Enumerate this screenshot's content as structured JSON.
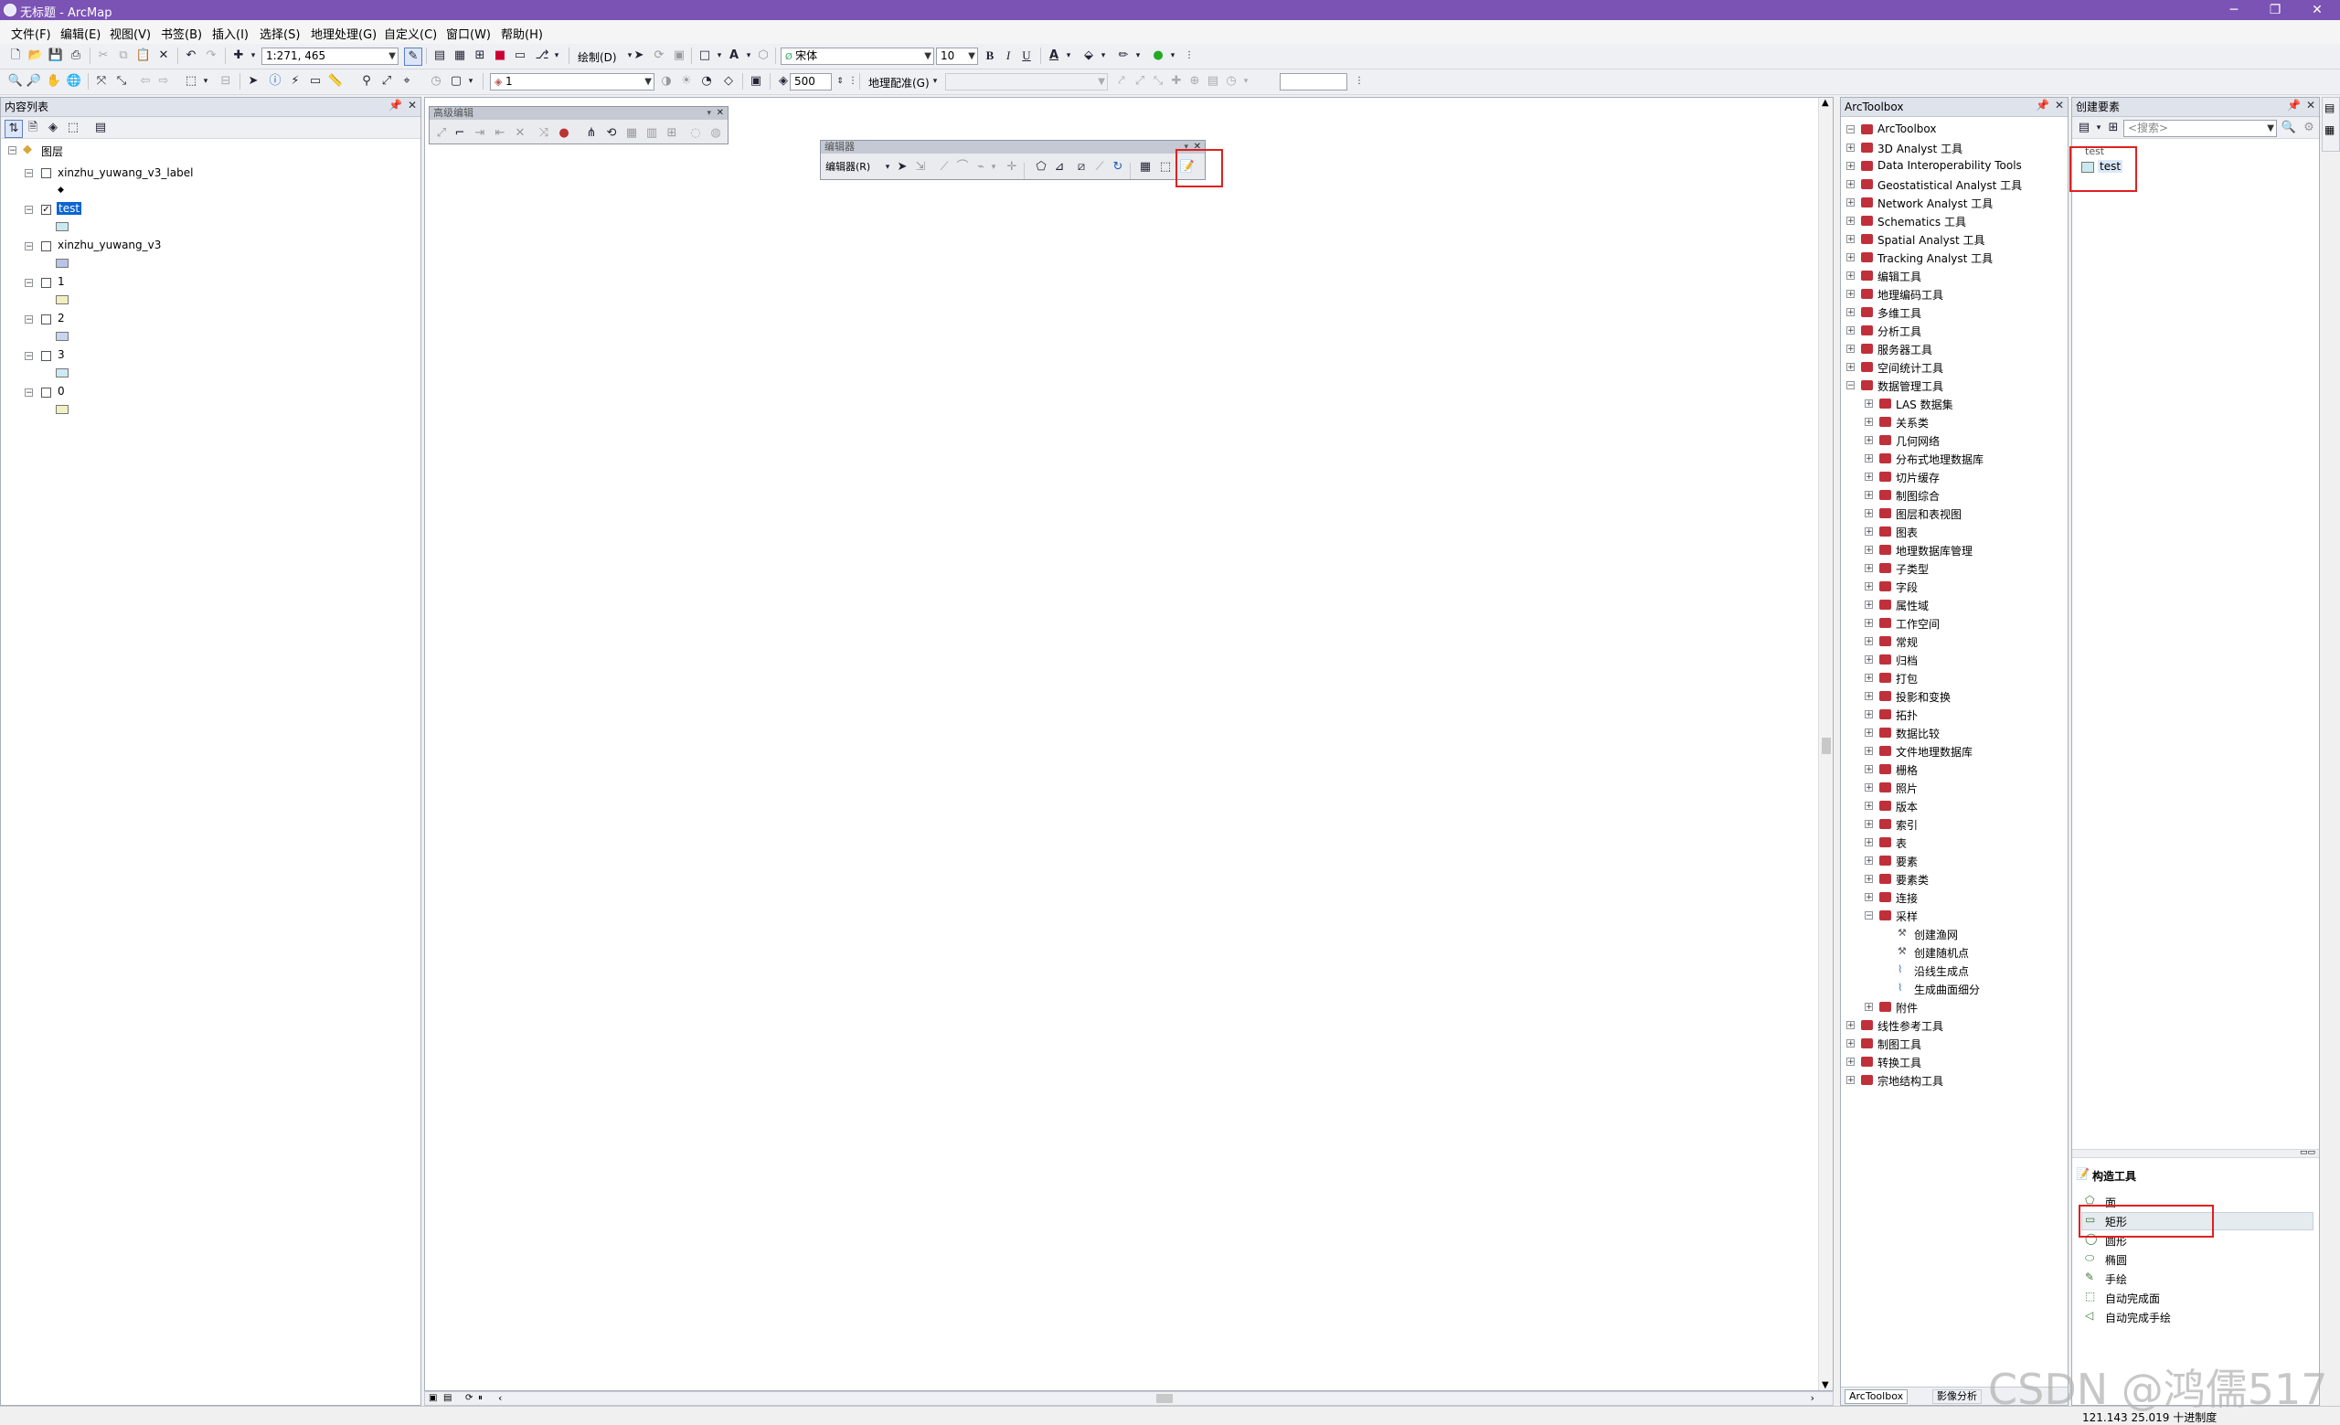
{
  "window": {
    "title": "无标题 - ArcMap",
    "controls": [
      "─",
      "❐",
      "✕"
    ]
  },
  "menubar": [
    "文件(F)",
    "编辑(E)",
    "视图(V)",
    "书签(B)",
    "插入(I)",
    "选择(S)",
    "地理处理(G)",
    "自定义(C)",
    "窗口(W)",
    "帮助(H)"
  ],
  "toolbar1": {
    "scale": "1:271, 465",
    "draw_label": "绘制(D)",
    "font_name": "宋体",
    "font_size": "10",
    "bold": "B",
    "italic": "I",
    "underline": "U",
    "text_tool": "A"
  },
  "toolbar2": {
    "layer_combo": "1",
    "value_500": "500",
    "georef_label": "地理配准(G)"
  },
  "toc": {
    "title": "内容列表",
    "root": "图层",
    "layers": [
      {
        "name": "xinzhu_yuwang_v3_label",
        "checked": false,
        "symbol": "point"
      },
      {
        "name": "test",
        "checked": true,
        "selected": true,
        "symbol": "#c9e9ee"
      },
      {
        "name": "xinzhu_yuwang_v3",
        "checked": false,
        "symbol": "#b9c4e6"
      },
      {
        "name": "1",
        "checked": false,
        "symbol": "#f1efc0"
      },
      {
        "name": "2",
        "checked": false,
        "symbol": "#c9d6f0"
      },
      {
        "name": "3",
        "checked": false,
        "symbol": "#cde9f3"
      },
      {
        "name": "0",
        "checked": false,
        "symbol": "#f1f0c5"
      }
    ]
  },
  "advanced_edit": {
    "title": "高级编辑"
  },
  "editor": {
    "title": "编辑器",
    "menu": "编辑器(R)"
  },
  "arctoolbox": {
    "title": "ArcToolbox",
    "root": "ArcToolbox",
    "toolboxes": [
      "3D Analyst 工具",
      "Data Interoperability Tools",
      "Geostatistical Analyst 工具",
      "Network Analyst 工具",
      "Schematics 工具",
      "Spatial Analyst 工具",
      "Tracking Analyst 工具",
      "编辑工具",
      "地理编码工具",
      "多维工具",
      "分析工具",
      "服务器工具",
      "空间统计工具",
      "数据管理工具"
    ],
    "data_mgmt_children": [
      "LAS 数据集",
      "关系类",
      "几何网络",
      "分布式地理数据库",
      "切片缓存",
      "制图综合",
      "图层和表视图",
      "图表",
      "地理数据库管理",
      "子类型",
      "字段",
      "属性域",
      "工作空间",
      "常规",
      "归档",
      "打包",
      "投影和变换",
      "拓扑",
      "数据比较",
      "文件地理数据库",
      "栅格",
      "照片",
      "版本",
      "索引",
      "表",
      "要素",
      "要素类",
      "连接",
      "采样"
    ],
    "sampling_tools": [
      "创建渔网",
      "创建随机点",
      "沿线生成点",
      "生成曲面细分"
    ],
    "after_sampling": [
      "附件"
    ],
    "more_toolboxes": [
      "线性参考工具",
      "制图工具",
      "转换工具",
      "宗地结构工具"
    ],
    "bottom_tabs": [
      "ArcToolbox",
      "影像分析"
    ]
  },
  "create_features": {
    "title": "创建要素",
    "search_placeholder": "<搜索>",
    "group_label": "test",
    "template": "test",
    "construction_title": "构造工具",
    "tools": [
      "面",
      "矩形",
      "圆形",
      "椭圆",
      "手绘",
      "自动完成面",
      "自动完成手绘"
    ],
    "selected_tool": "矩形"
  },
  "status": {
    "coords": "121.143  25.019 十进制度"
  },
  "watermark": "CSDN @鸿儒517",
  "colors": {
    "titlebar": "#7b53b4",
    "highlight": "#e02020",
    "selection": "#0a64d2",
    "toolbox_icon": "#c0303a"
  }
}
